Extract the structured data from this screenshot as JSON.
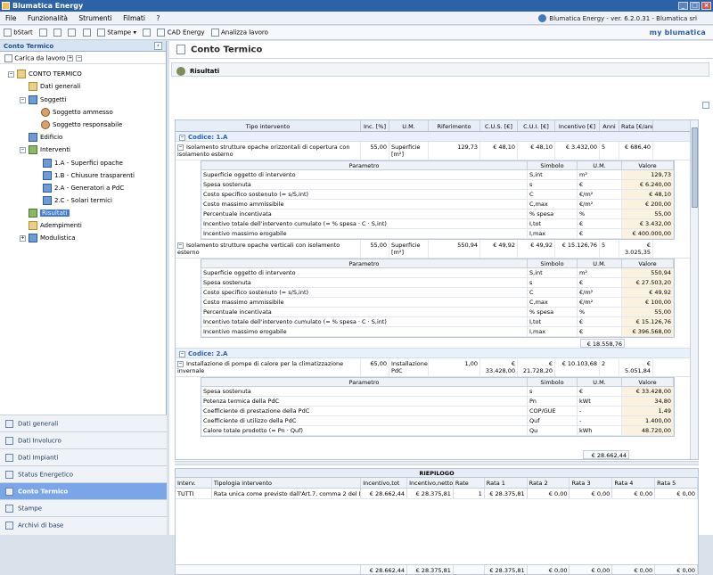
{
  "window": {
    "title": "Blumatica Energy"
  },
  "menu": {
    "items": [
      "File",
      "Funzionalità",
      "Strumenti",
      "Filmati",
      "?"
    ],
    "brand": "Blumatica Energy - ver. 6.2.0.31 - Blumatica srl"
  },
  "toolbar": {
    "items": [
      "bStart",
      "Stampe",
      "CAD Energy",
      "Analizza lavoro"
    ],
    "logo": "my blumatica"
  },
  "sidebar": {
    "title": "Conto Termico",
    "carica": "Carica da lavoro",
    "tree": [
      {
        "label": "CONTO TERMICO"
      },
      {
        "label": "Dati generali"
      },
      {
        "label": "Soggetti"
      },
      {
        "label": "Soggetto ammesso"
      },
      {
        "label": "Soggetto responsabile"
      },
      {
        "label": "Edificio"
      },
      {
        "label": "Interventi"
      },
      {
        "label": "1.A - Superfici opache"
      },
      {
        "label": "1.B - Chiusure trasparenti"
      },
      {
        "label": "2.A - Generatori a PdC"
      },
      {
        "label": "2.C - Solari termici"
      },
      {
        "label": "Risultati"
      },
      {
        "label": "Adempimenti"
      },
      {
        "label": "Modulistica"
      }
    ],
    "nav": [
      {
        "label": "Dati generali"
      },
      {
        "label": "Dati Involucro"
      },
      {
        "label": "Dati Impianti"
      },
      {
        "label": "Status Energetico"
      },
      {
        "label": "Conto Termico"
      },
      {
        "label": "Stampe"
      },
      {
        "label": "Archivi di base"
      }
    ]
  },
  "main": {
    "title": "Conto Termico",
    "results_title": "Risultati",
    "headers": [
      "Tipo intervento",
      "Inc. [%]",
      "U.M.",
      "Riferimento",
      "C.U.S. [€]",
      "C.U.I. [€]",
      "Incentivo [€]",
      "Anni",
      "Rata [€/anno]"
    ],
    "code1": "Codice: 1.A",
    "code2": "Codice: 2.A",
    "rows": [
      {
        "tipo": "Isolamento strutture opache orizzontali di copertura con isolamento esterno",
        "inc": "55,00",
        "um": "Superficie [m²]",
        "rif": "129,73",
        "cus": "€ 48,10",
        "cui": "€ 48,10",
        "inc_val": "€ 3.432,00",
        "anni": "5",
        "rata": "€ 686,40"
      },
      {
        "tipo": "Isolamento strutture opache verticali con isolamento esterno",
        "inc": "55,00",
        "um": "Superficie [m²]",
        "rif": "550,94",
        "cus": "€ 49,92",
        "cui": "€ 49,92",
        "inc_val": "€ 15.126,76",
        "anni": "5",
        "rata": "€ 3.025,35"
      },
      {
        "tipo": "Installazione di pompe di calore per la climatizzazione invernale",
        "inc": "65,00",
        "um": "Installazione PdC",
        "rif": "1,00",
        "cus": "€ 33.428,00",
        "cui": "€ 21.728,20",
        "inc_val": "€ 10.103,68",
        "anni": "2",
        "rata": "€ 5.051,84"
      }
    ],
    "param_headers": [
      "Parametro",
      "Simbolo",
      "U.M.",
      "Valore"
    ],
    "param1": [
      [
        "Superficie oggetto di intervento",
        "S,int",
        "m²",
        "129,73"
      ],
      [
        "Spesa sostenuta",
        "s",
        "€",
        "€ 6.240,00"
      ],
      [
        "Costo specifico sostenuto (= s/S,int)",
        "C",
        "€/m²",
        "€ 48,10"
      ],
      [
        "Costo massimo ammissibile",
        "C,max",
        "€/m²",
        "€ 200,00"
      ],
      [
        "Percentuale incentivata",
        "% spesa",
        "%",
        "55,00"
      ],
      [
        "Incentivo totale dell'intervento cumulato (= % spesa · C · S,int)",
        "I,tot",
        "€",
        "€ 3.432,00"
      ],
      [
        "Incentivo massimo erogabile",
        "I,max",
        "€",
        "€ 400.000,00"
      ]
    ],
    "param2": [
      [
        "Superficie oggetto di intervento",
        "S,int",
        "m²",
        "550,94"
      ],
      [
        "Spesa sostenuta",
        "s",
        "€",
        "€ 27.503,20"
      ],
      [
        "Costo specifico sostenuto (= s/S,int)",
        "C",
        "€/m²",
        "€ 49,92"
      ],
      [
        "Costo massimo ammissibile",
        "C,max",
        "€/m²",
        "€ 100,00"
      ],
      [
        "Percentuale incentivata",
        "% spesa",
        "%",
        "55,00"
      ],
      [
        "Incentivo totale dell'intervento cumulato (= % spesa · C · S,int)",
        "I,tot",
        "€",
        "€ 15.126,76"
      ],
      [
        "Incentivo massimo erogabile",
        "I,max",
        "€",
        "€ 396.568,00"
      ]
    ],
    "subtotal1": "€ 18.558,76",
    "param3": [
      [
        "Spesa sostenuta",
        "s",
        "€",
        "€ 33.428,00"
      ],
      [
        "Potenza termica della PdC",
        "Pn",
        "kWt",
        "34,80"
      ],
      [
        "Coefficiente di prestazione della PdC",
        "COP/GUE",
        "-",
        "1,49"
      ],
      [
        "Coefficiente di utilizzo della PdC",
        "Quf",
        "-",
        "1.400,00"
      ],
      [
        "Calore totale prodotto (= Pn · Quf)",
        "Qu",
        "kWh",
        "48.720,00"
      ]
    ],
    "grand_total": "€ 28.662,44"
  },
  "riepilogo": {
    "title": "RIEPILOGO",
    "headers": [
      "Interv.",
      "Tipologia intervento",
      "Incentivo,tot",
      "Incentivo,netto",
      "Rate",
      "Rata 1",
      "Rata 2",
      "Rata 3",
      "Rata 4",
      "Rata 5"
    ],
    "row": [
      "TUTTI",
      "Rata unica come previsto dall'Art.7, comma 2 del D.M. ...",
      "€ 28.662,44",
      "€ 28.375,81",
      "1",
      "€ 28.375,81",
      "€ 0,00",
      "€ 0,00",
      "€ 0,00",
      "€ 0,00"
    ],
    "totals": [
      "€ 28.662,44",
      "€ 28.375,81",
      "€ 28.375,81",
      "€ 0,00",
      "€ 0,00",
      "€ 0,00",
      "€ 0,00"
    ]
  }
}
